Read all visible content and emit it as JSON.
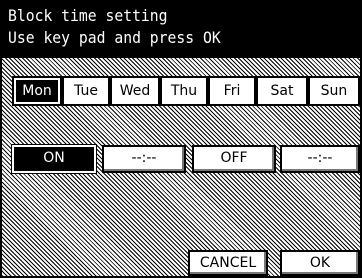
{
  "header": {
    "title": "Block time setting",
    "instruction": "Use key pad and press OK"
  },
  "days": [
    {
      "label": "Mon",
      "selected": true
    },
    {
      "label": "Tue",
      "selected": false
    },
    {
      "label": "Wed",
      "selected": false
    },
    {
      "label": "Thu",
      "selected": false
    },
    {
      "label": "Fri",
      "selected": false
    },
    {
      "label": "Sat",
      "selected": false
    },
    {
      "label": "Sun",
      "selected": false
    }
  ],
  "block": {
    "on_label": "ON",
    "on_time": "--:--",
    "off_label": "OFF",
    "off_time": "--:--",
    "selected": "ON"
  },
  "actions": {
    "cancel_label": "CANCEL",
    "ok_label": "OK"
  }
}
